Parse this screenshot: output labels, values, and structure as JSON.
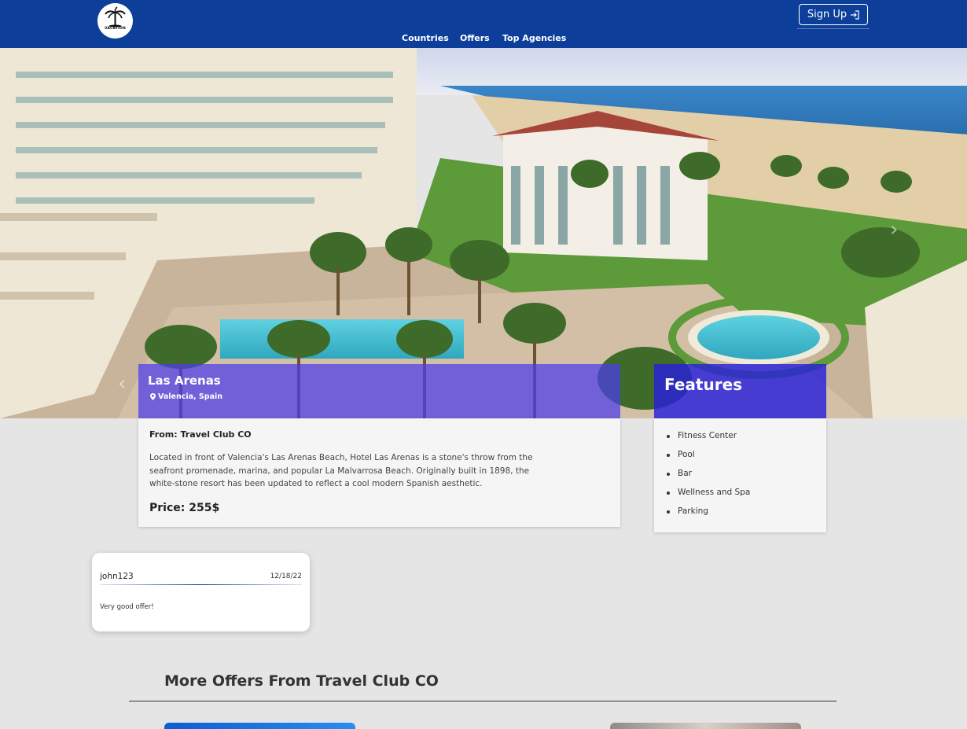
{
  "nav": {
    "logo_text": "VACATION",
    "links": [
      "Countries",
      "Offers",
      "Top Agencies"
    ],
    "signup_label": "Sign Up"
  },
  "offer": {
    "title": "Las Arenas",
    "location": "Valencia, Spain",
    "from": "From: Travel Club CO",
    "description": "Located in front of Valencia's Las Arenas Beach, Hotel Las Arenas is a stone's throw from the seafront promenade, marina, and popular La Malvarrosa Beach. Originally built in 1898, the white-stone resort has been updated to reflect a cool modern Spanish aesthetic.",
    "price": "Price: 255$"
  },
  "features": {
    "title": "Features",
    "items": [
      "Fitness Center",
      "Pool",
      "Bar",
      "Wellness and Spa",
      "Parking"
    ]
  },
  "review": {
    "user": "john123",
    "date": "12/18/22",
    "text": "Very good offer!"
  },
  "more_offers": {
    "title": "More Offers From Travel Club CO"
  },
  "colors": {
    "nav_bg": "#0d3f9a",
    "overlay": "#4b3ceb",
    "page_bg": "#e5e5e5"
  }
}
